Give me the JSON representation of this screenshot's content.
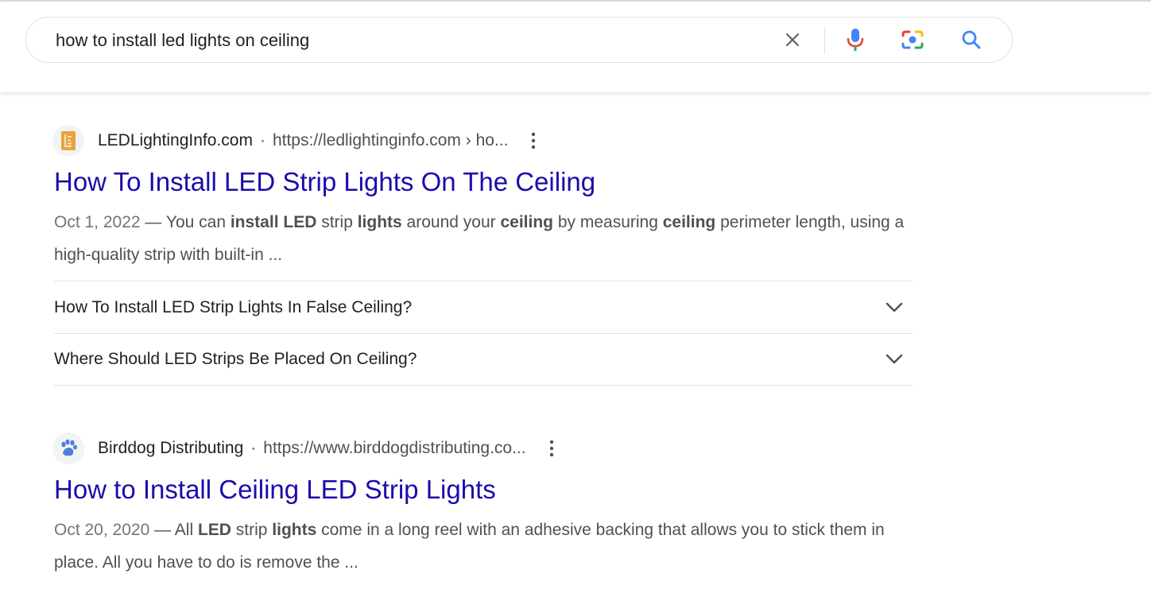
{
  "search": {
    "query": "how to install led lights on ceiling",
    "icons": [
      "close-icon",
      "microphone-icon",
      "camera-lens-icon",
      "search-icon"
    ]
  },
  "results": [
    {
      "site_name": "LEDLightingInfo.com",
      "separator": "·",
      "url": "https://ledlightinginfo.com › ho...",
      "favicon_icon": "led-lighting-info-favicon",
      "title": "How To Install LED Strip Lights On The Ceiling",
      "date": "Oct 1, 2022",
      "dash": " — ",
      "snippet_parts": [
        "You can ",
        "install LED",
        " strip ",
        "lights",
        " around your ",
        "ceiling",
        " by measuring ",
        "ceiling",
        " perimeter length, using a high-quality strip with built-in ..."
      ],
      "questions": [
        "How To Install LED Strip Lights In False Ceiling?",
        "Where Should LED Strips Be Placed On Ceiling?"
      ]
    },
    {
      "site_name": "Birddog Distributing",
      "separator": "·",
      "url": "https://www.birddogdistributing.co...",
      "favicon_icon": "paw-print-icon",
      "title": "How to Install Ceiling LED Strip Lights",
      "date": "Oct 20, 2020",
      "dash": " — ",
      "snippet_parts": [
        "All ",
        "LED",
        " strip ",
        "lights",
        " come in a long reel with an adhesive backing that allows you to stick them in place. All you have to do is remove the ..."
      ]
    }
  ],
  "colors": {
    "link": "#1a0dab",
    "text": "#202124",
    "secondary": "#4d5156",
    "mic_blue": "#4285f4",
    "mic_red": "#ea4335",
    "favicon_led": "#e8a33d"
  }
}
